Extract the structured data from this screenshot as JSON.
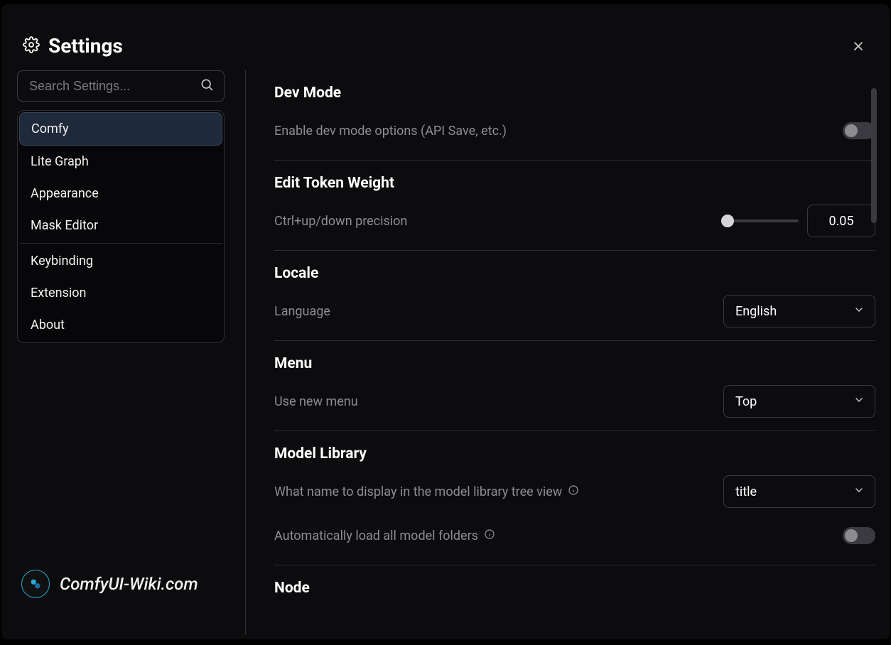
{
  "header": {
    "title": "Settings"
  },
  "search": {
    "placeholder": "Search Settings..."
  },
  "sidebar": {
    "items": [
      {
        "label": "Comfy",
        "active": true
      },
      {
        "label": "Lite Graph"
      },
      {
        "label": "Appearance"
      },
      {
        "label": "Mask Editor"
      },
      {
        "label": "Keybinding"
      },
      {
        "label": "Extension"
      },
      {
        "label": "About"
      }
    ],
    "divider_after_index": 3
  },
  "sections": {
    "dev_mode": {
      "title": "Dev Mode",
      "enable_label": "Enable dev mode options (API Save, etc.)",
      "enabled": false
    },
    "edit_token_weight": {
      "title": "Edit Token Weight",
      "precision_label": "Ctrl+up/down precision",
      "precision_value": "0.05"
    },
    "locale": {
      "title": "Locale",
      "language_label": "Language",
      "language_value": "English"
    },
    "menu": {
      "title": "Menu",
      "use_new_menu_label": "Use new menu",
      "use_new_menu_value": "Top"
    },
    "model_library": {
      "title": "Model Library",
      "display_name_label": "What name to display in the model library tree view",
      "display_name_value": "title",
      "auto_load_label": "Automatically load all model folders",
      "auto_load_enabled": false
    },
    "node": {
      "title": "Node"
    }
  },
  "watermark": {
    "text": "ComfyUI-Wiki.com"
  }
}
